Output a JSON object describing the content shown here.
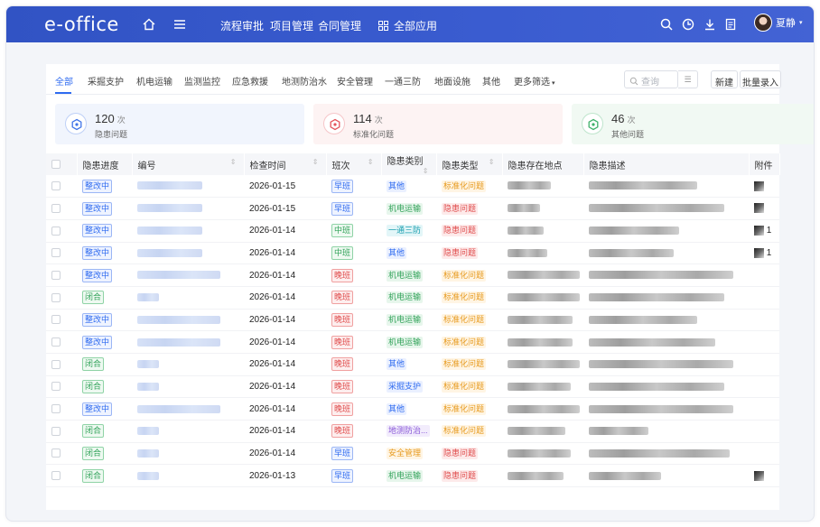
{
  "app": {
    "logo": "e-office"
  },
  "topnav": {
    "items": [
      "流程审批",
      "项目管理",
      "合同管理"
    ],
    "apps_label": "全部应用",
    "user_name": "夏静"
  },
  "filters": {
    "tabs": [
      "全部",
      "采掘支护",
      "机电运输",
      "监测监控",
      "应急救援",
      "地测防治水",
      "安全管理",
      "一通三防",
      "地面设施",
      "其他",
      "更多筛选"
    ],
    "search_placeholder": "查询",
    "new_label": "新建",
    "batch_label": "批量录入"
  },
  "stats": [
    {
      "count": "120",
      "unit": "次",
      "label": "隐患问题",
      "color": "#3f74e8",
      "bg": "#f1f5fd"
    },
    {
      "count": "114",
      "unit": "次",
      "label": "标准化问题",
      "color": "#e4545c",
      "bg": "#fdf3f3"
    },
    {
      "count": "46",
      "unit": "次",
      "label": "其他问题",
      "color": "#3fb06a",
      "bg": "#f1f9f3"
    }
  ],
  "table": {
    "headers": [
      "隐患进度",
      "编号",
      "检查时间",
      "班次",
      "隐患类别",
      "隐患类型",
      "隐患存在地点",
      "隐患描述",
      "附件"
    ],
    "rows": [
      {
        "progress": "整改中",
        "pc": "blue",
        "date": "2026-01-15",
        "shift": "早班",
        "sc": "blue",
        "category": "其他",
        "cc": "bluen",
        "type": "标准化问题",
        "tc": "orangen",
        "id_w": 72,
        "loc_w": 48,
        "desc_w": 120,
        "thumb": true,
        "thumb_text": ""
      },
      {
        "progress": "整改中",
        "pc": "blue",
        "date": "2026-01-15",
        "shift": "早班",
        "sc": "blue",
        "category": "机电运输",
        "cc": "greenn",
        "type": "隐患问题",
        "tc": "redn",
        "id_w": 72,
        "loc_w": 36,
        "desc_w": 150,
        "thumb": true,
        "thumb_text": ""
      },
      {
        "progress": "整改中",
        "pc": "blue",
        "date": "2026-01-14",
        "shift": "中班",
        "sc": "green",
        "category": "一通三防",
        "cc": "cyann",
        "type": "隐患问题",
        "tc": "redn",
        "id_w": 72,
        "loc_w": 40,
        "desc_w": 100,
        "thumb": true,
        "thumb_text": "1"
      },
      {
        "progress": "整改中",
        "pc": "blue",
        "date": "2026-01-14",
        "shift": "中班",
        "sc": "green",
        "category": "其他",
        "cc": "bluen",
        "type": "隐患问题",
        "tc": "redn",
        "id_w": 72,
        "loc_w": 44,
        "desc_w": 94,
        "thumb": true,
        "thumb_text": "1"
      },
      {
        "progress": "整改中",
        "pc": "blue",
        "date": "2026-01-14",
        "shift": "晚班",
        "sc": "red",
        "category": "机电运输",
        "cc": "greenn",
        "type": "标准化问题",
        "tc": "orangen",
        "id_w": 92,
        "loc_w": 80,
        "desc_w": 160,
        "thumb": false,
        "thumb_text": ""
      },
      {
        "progress": "闭合",
        "pc": "green",
        "date": "2026-01-14",
        "shift": "晚班",
        "sc": "red",
        "category": "机电运输",
        "cc": "greenn",
        "type": "标准化问题",
        "tc": "orangen",
        "id_w": 24,
        "loc_w": 80,
        "desc_w": 150,
        "thumb": false,
        "thumb_text": ""
      },
      {
        "progress": "整改中",
        "pc": "blue",
        "date": "2026-01-14",
        "shift": "晚班",
        "sc": "red",
        "category": "机电运输",
        "cc": "greenn",
        "type": "标准化问题",
        "tc": "orangen",
        "id_w": 92,
        "loc_w": 72,
        "desc_w": 120,
        "thumb": false,
        "thumb_text": ""
      },
      {
        "progress": "整改中",
        "pc": "blue",
        "date": "2026-01-14",
        "shift": "晚班",
        "sc": "red",
        "category": "机电运输",
        "cc": "greenn",
        "type": "标准化问题",
        "tc": "orangen",
        "id_w": 92,
        "loc_w": 72,
        "desc_w": 140,
        "thumb": false,
        "thumb_text": ""
      },
      {
        "progress": "闭合",
        "pc": "green",
        "date": "2026-01-14",
        "shift": "晚班",
        "sc": "red",
        "category": "其他",
        "cc": "bluen",
        "type": "标准化问题",
        "tc": "orangen",
        "id_w": 24,
        "loc_w": 80,
        "desc_w": 160,
        "thumb": false,
        "thumb_text": ""
      },
      {
        "progress": "闭合",
        "pc": "green",
        "date": "2026-01-14",
        "shift": "晚班",
        "sc": "red",
        "category": "采掘支护",
        "cc": "bluen",
        "type": "标准化问题",
        "tc": "orangen",
        "id_w": 24,
        "loc_w": 70,
        "desc_w": 150,
        "thumb": false,
        "thumb_text": ""
      },
      {
        "progress": "整改中",
        "pc": "blue",
        "date": "2026-01-14",
        "shift": "晚班",
        "sc": "red",
        "category": "其他",
        "cc": "bluen",
        "type": "标准化问题",
        "tc": "orangen",
        "id_w": 92,
        "loc_w": 80,
        "desc_w": 160,
        "thumb": false,
        "thumb_text": ""
      },
      {
        "progress": "闭合",
        "pc": "green",
        "date": "2026-01-14",
        "shift": "晚班",
        "sc": "red",
        "category": "地测防治...",
        "cc": "purplen",
        "type": "标准化问题",
        "tc": "orangen",
        "id_w": 24,
        "loc_w": 64,
        "desc_w": 66,
        "thumb": false,
        "thumb_text": ""
      },
      {
        "progress": "闭合",
        "pc": "green",
        "date": "2026-01-14",
        "shift": "早班",
        "sc": "blue",
        "category": "安全管理",
        "cc": "orangen",
        "type": "隐患问题",
        "tc": "redn",
        "id_w": 24,
        "loc_w": 70,
        "desc_w": 156,
        "thumb": false,
        "thumb_text": ""
      },
      {
        "progress": "闭合",
        "pc": "green",
        "date": "2026-01-13",
        "shift": "早班",
        "sc": "blue",
        "category": "机电运输",
        "cc": "greenn",
        "type": "隐患问题",
        "tc": "redn",
        "id_w": 24,
        "loc_w": 62,
        "desc_w": 80,
        "thumb": true,
        "thumb_text": ""
      }
    ]
  }
}
